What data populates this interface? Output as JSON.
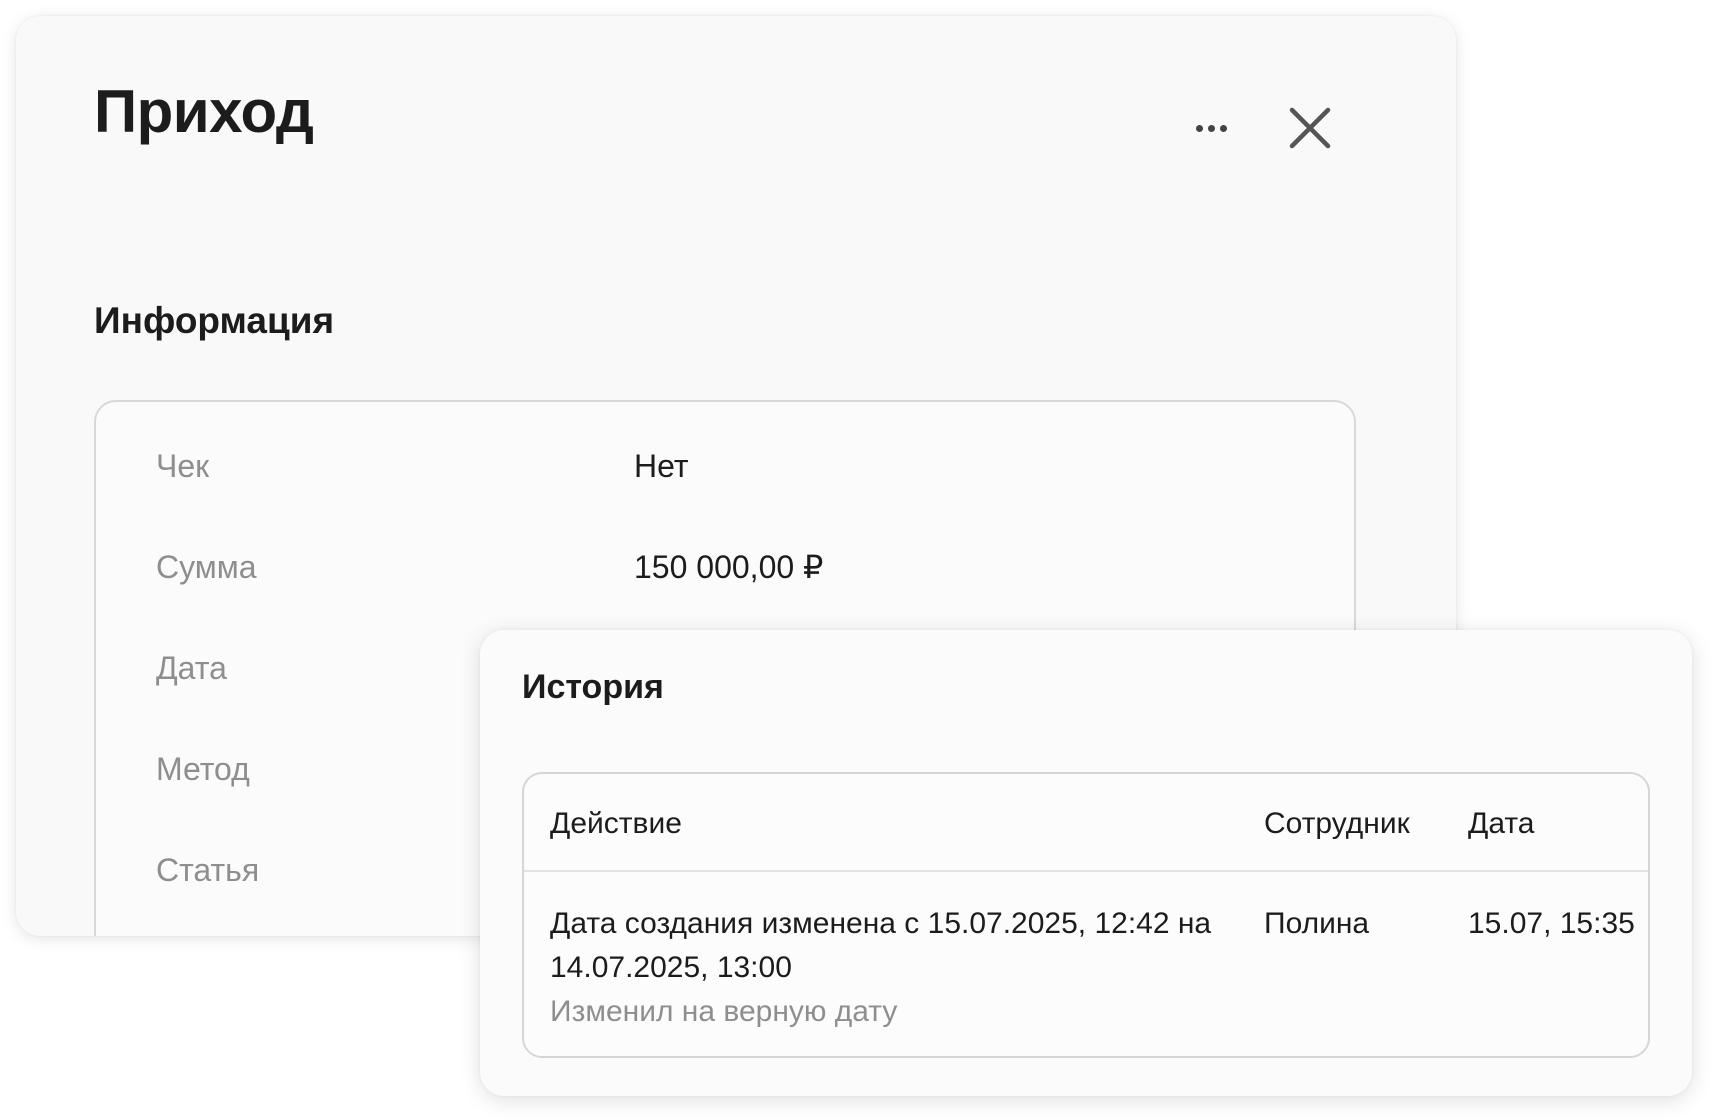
{
  "modal": {
    "title": "Приход",
    "more_icon": "more-horizontal-icon",
    "close_icon": "close-icon"
  },
  "info": {
    "section_title": "Информация",
    "rows": [
      {
        "label": "Чек",
        "value": "Нет"
      },
      {
        "label": "Сумма",
        "value": "150 000,00 ₽"
      },
      {
        "label": "Дата",
        "value": ""
      },
      {
        "label": "Метод",
        "value": ""
      },
      {
        "label": "Статья",
        "value": ""
      }
    ]
  },
  "history": {
    "title": "История",
    "columns": {
      "action": "Действие",
      "employee": "Сотрудник",
      "date": "Дата"
    },
    "rows": [
      {
        "action": "Дата создания изменена с 15.07.2025, 12:42 на 14.07.2025, 13:00",
        "note": "Изменил на верную дату",
        "employee": "Полина",
        "date": "15.07, 15:35"
      }
    ]
  }
}
